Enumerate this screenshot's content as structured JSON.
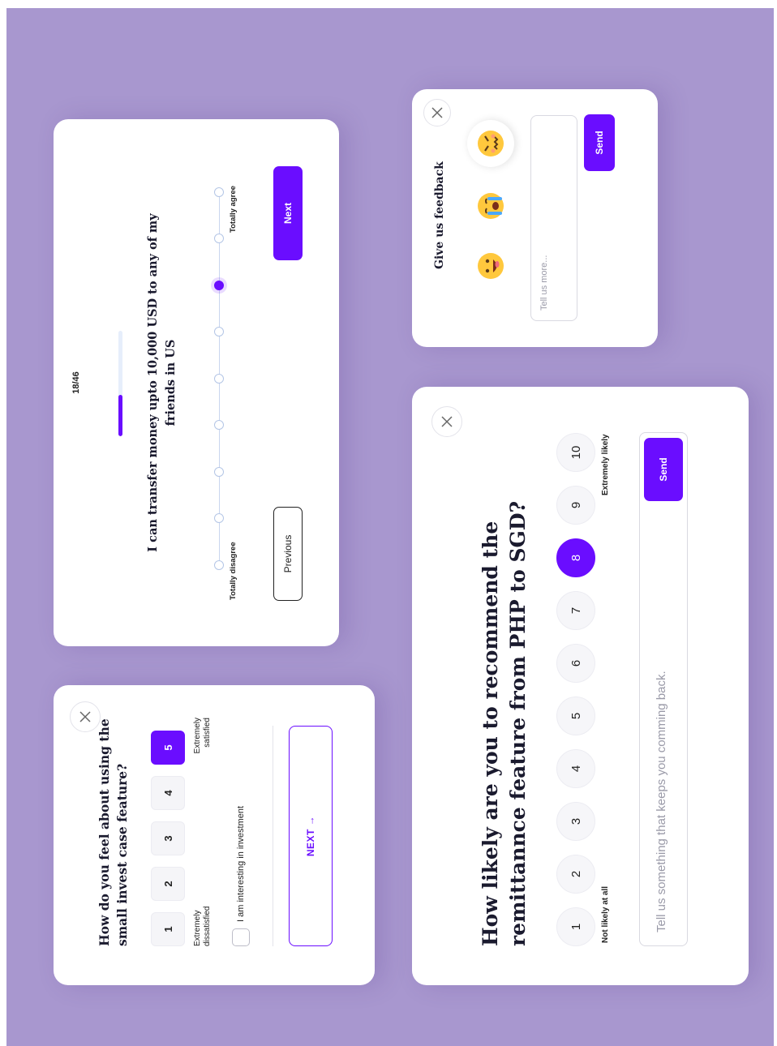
{
  "colors": {
    "background": "#a897cf",
    "accent": "#6a0dff",
    "card": "#ffffff"
  },
  "invest_card": {
    "title": "How do you feel about using the small invest case feature?",
    "options": [
      "1",
      "2",
      "3",
      "4",
      "5"
    ],
    "selected": "5",
    "label_min": "Extremely dissatisfied",
    "label_max": "Extremely satisfied",
    "checkbox_label": "I am interesting in investment",
    "checkbox_checked": false,
    "next_label": "NEXT →",
    "close_icon": "close-icon"
  },
  "agree_card": {
    "progress_text": "18/46",
    "progress_fraction": 0.39,
    "question": "I can transfer money upto 10,000 USD to any of my friends in US",
    "scale_points": 9,
    "selected_point": 7,
    "label_min": "Totally disagree",
    "label_max": "Totally agree",
    "previous_label": "Previous",
    "next_label": "Next"
  },
  "feedback_card": {
    "title": "Give us feedback",
    "emojis": [
      {
        "name": "grinning-face-icon",
        "glyph": "😜",
        "selected": false
      },
      {
        "name": "crying-face-icon",
        "glyph": "😭",
        "selected": false
      },
      {
        "name": "angry-face-icon",
        "glyph": "😖",
        "selected": true
      }
    ],
    "input_placeholder": "Tell us more...",
    "send_label": "Send",
    "close_icon": "close-icon"
  },
  "nps_card": {
    "title": "How likely are you to recommend the remittannce feature from PHP to SGD?",
    "options": [
      "1",
      "2",
      "3",
      "4",
      "5",
      "6",
      "7",
      "8",
      "9",
      "10"
    ],
    "selected": "8",
    "label_min": "Not likely at all",
    "label_max": "Extremely likely",
    "input_placeholder": "Tell us something that keeps you comming back.",
    "send_label": "Send",
    "close_icon": "close-icon"
  }
}
